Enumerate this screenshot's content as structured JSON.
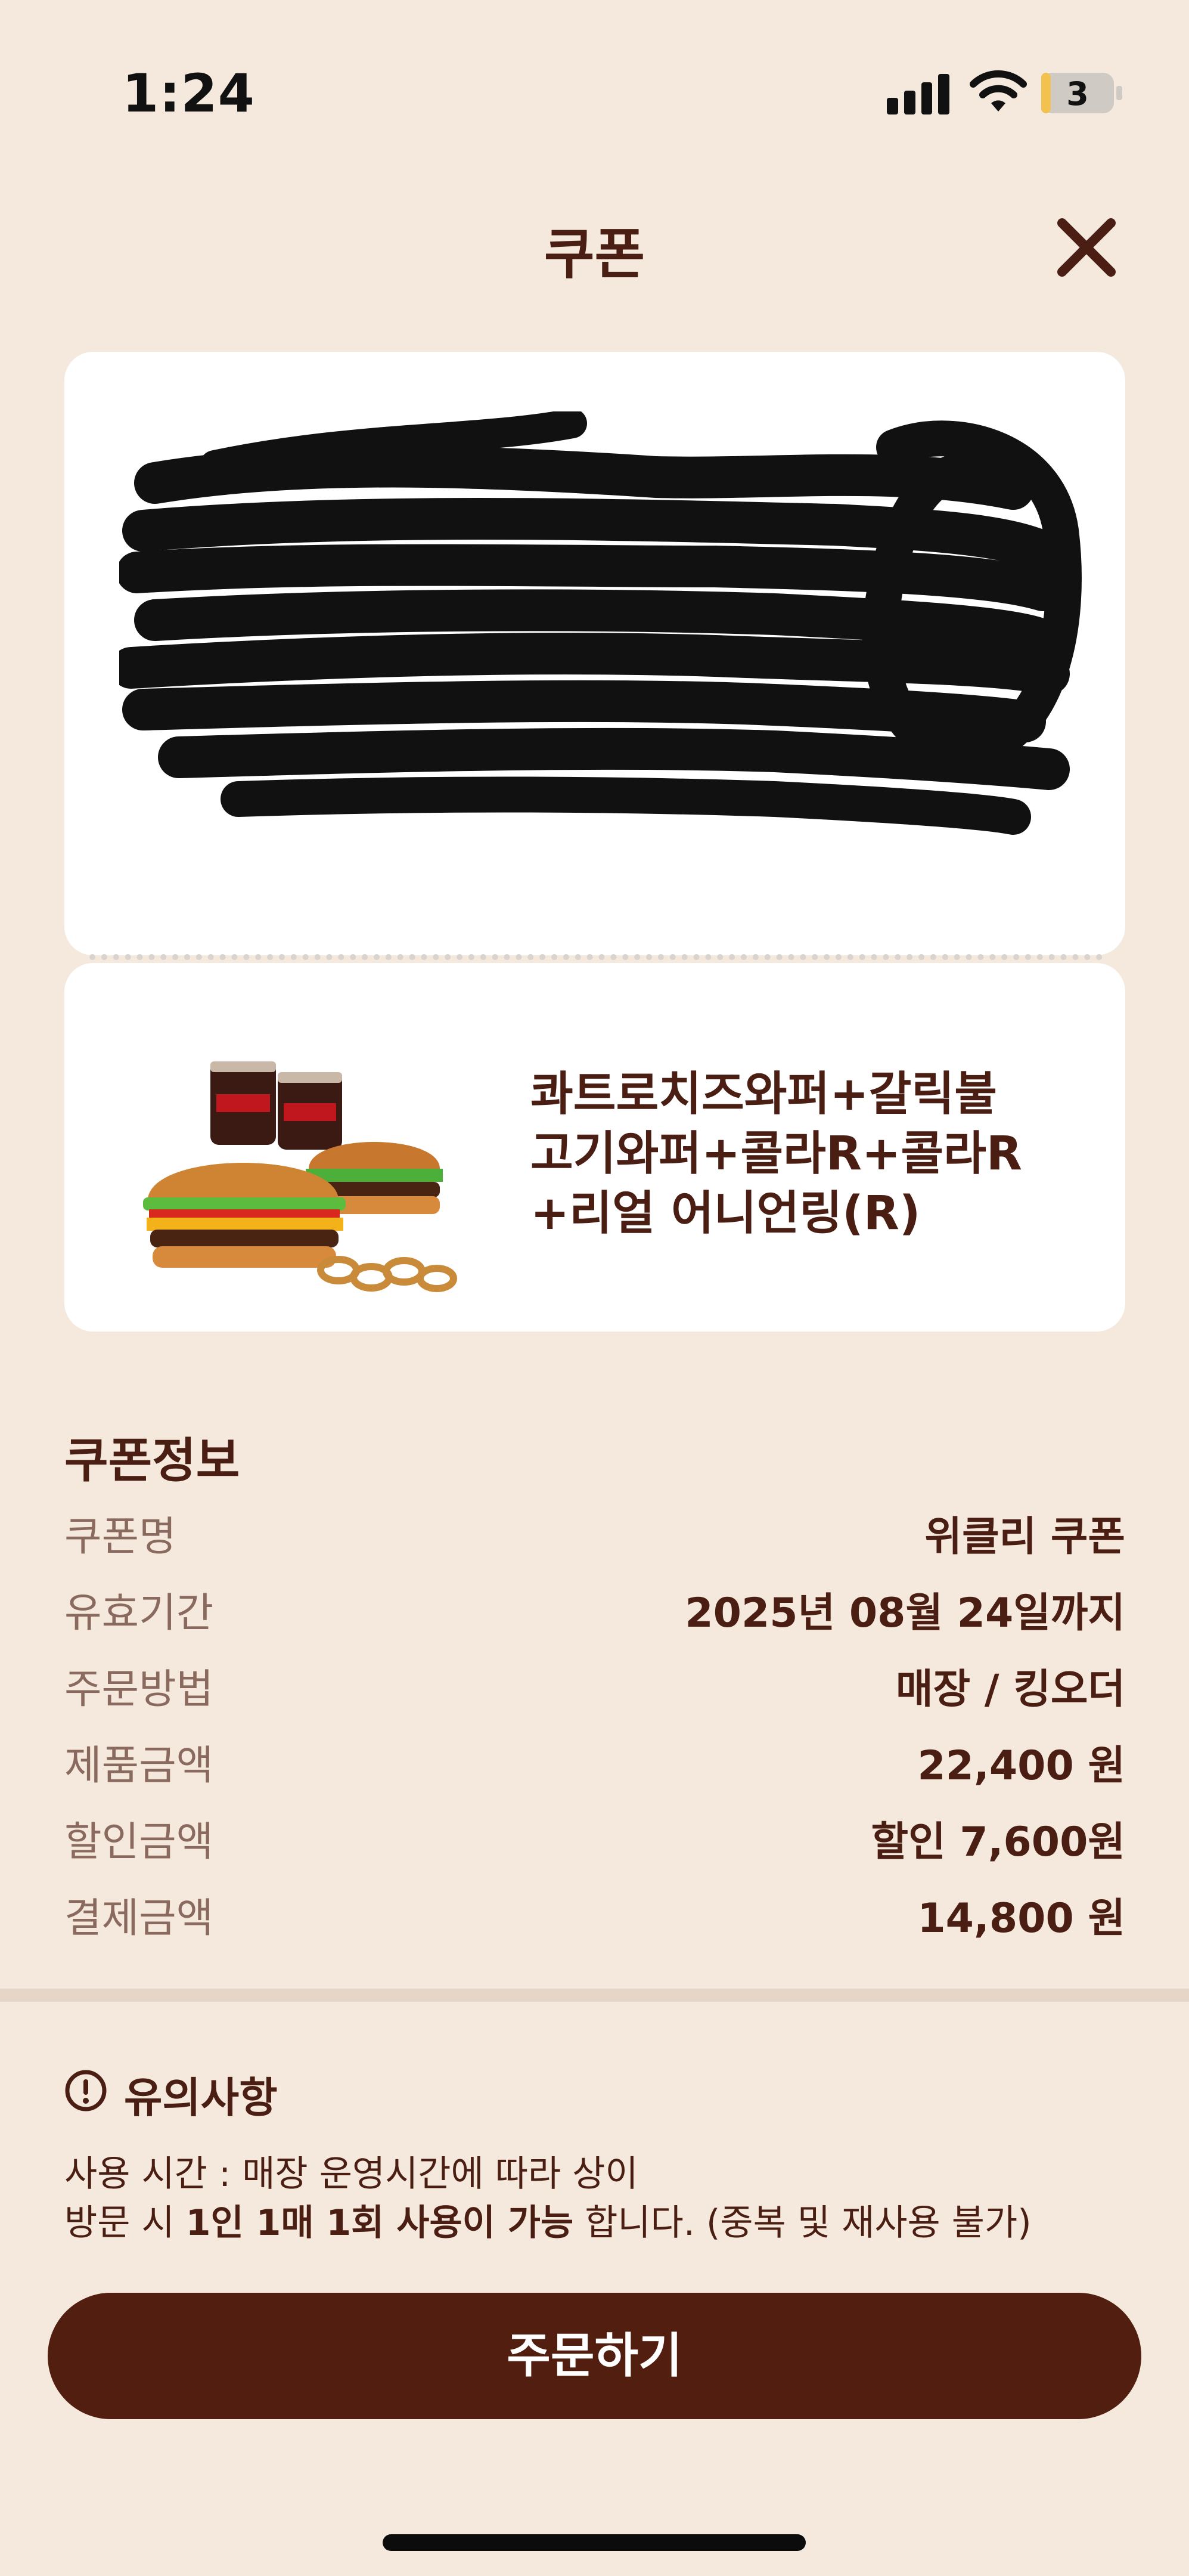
{
  "status_bar": {
    "time": "1:24",
    "battery_level": "3"
  },
  "header": {
    "title": "쿠폰",
    "close_icon": "close-icon"
  },
  "barcode": {
    "redacted": true,
    "icon": "redaction-scribble"
  },
  "product": {
    "name": "콰트로치즈와퍼+갈릭불\n고기와퍼+콜라R+콜라R\n+리얼 어니언링(R)",
    "image_icon": "burger-set-image"
  },
  "coupon_info": {
    "title": "쿠폰정보",
    "rows": [
      {
        "label": "쿠폰명",
        "value": "위클리 쿠폰"
      },
      {
        "label": "유효기간",
        "value": "2025년 08월 24일까지"
      },
      {
        "label": "주문방법",
        "value": "매장 / 킹오더"
      },
      {
        "label": "제품금액",
        "value": "22,400 원"
      },
      {
        "label": "할인금액",
        "value": "할인 7,600원"
      },
      {
        "label": "결제금액",
        "value": "14,800 원"
      }
    ]
  },
  "notice": {
    "title": "유의사항",
    "line1": "사용 시간 : 매장 운영시간에 따라 상이",
    "line2_prefix": "방문 시 ",
    "line2_bold": "1인 1매 1회 사용이 가능",
    "line2_suffix": " 합니다. (중복 및 재사용 불가)"
  },
  "order_button": {
    "label": "주문하기"
  },
  "colors": {
    "background": "#f4e9dc",
    "brand": "#521e10",
    "label": "#8a6a5e"
  }
}
